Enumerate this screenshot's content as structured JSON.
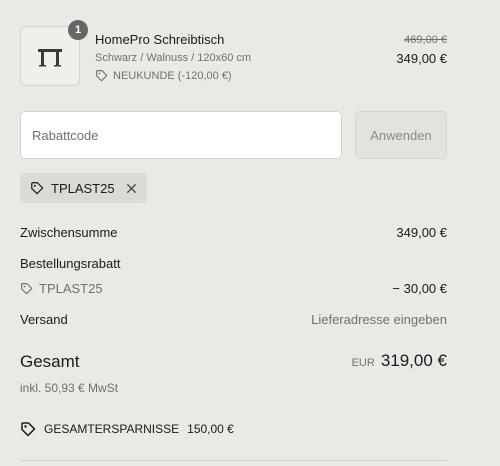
{
  "product": {
    "title": "HomePro Schreibtisch",
    "variant": "Schwarz / Walnuss / 120x60 cm",
    "discount_label": "NEUKUNDE (-120,00 €)",
    "quantity": "1",
    "original_price": "469,00 €",
    "price": "349,00 €",
    "image_icon": "desk-icon"
  },
  "discount_form": {
    "placeholder": "Rabattcode",
    "apply_label": "Anwenden"
  },
  "applied_code": {
    "code": "TPLAST25"
  },
  "summary": {
    "subtotal_label": "Zwischensumme",
    "subtotal_value": "349,00 €",
    "order_discount_label": "Bestellungsrabatt",
    "order_discount_code": "TPLAST25",
    "order_discount_value": "− 30,00 €",
    "shipping_label": "Versand",
    "shipping_value": "Lieferadresse eingeben",
    "total_label": "Gesamt",
    "currency": "EUR",
    "total_value": "319,00 €",
    "tax_note": "inkl. 50,93 € MwSt",
    "savings_label": "GESAMTERSPARNISSE",
    "savings_value": "150,00 €"
  },
  "colors": {
    "background": "#ebe9e5",
    "text": "#1a1a1a",
    "muted": "#707070",
    "chip": "#dcdad6",
    "badge": "#666666"
  }
}
